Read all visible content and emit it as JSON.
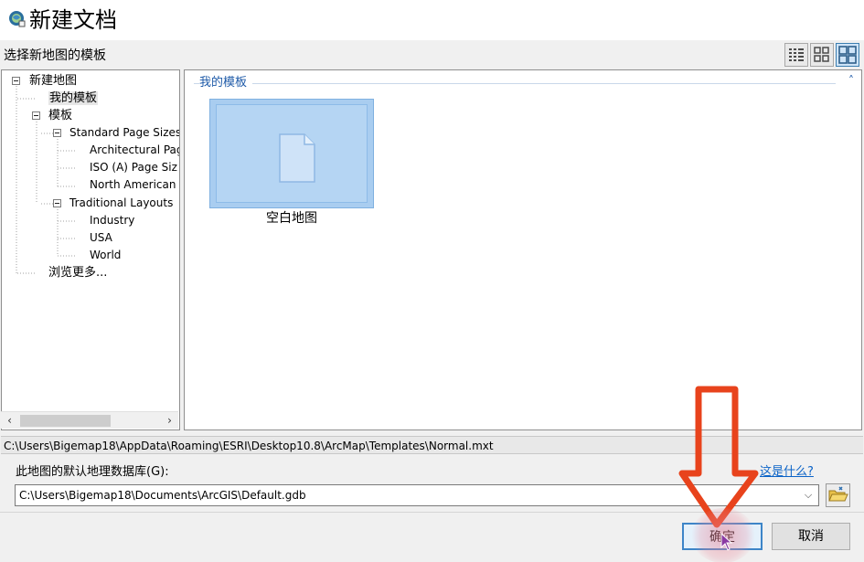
{
  "window": {
    "title": "新建文档",
    "app_icon": "arcmap-globe-icon"
  },
  "section": {
    "label": "选择新地图的模板",
    "view_buttons": [
      "details-view-icon",
      "medium-icons-view-icon",
      "large-icons-view-icon"
    ]
  },
  "tree": {
    "items": [
      {
        "label": "新建地图"
      },
      {
        "label": "我的模板"
      },
      {
        "label": "模板"
      },
      {
        "label": "Standard Page Sizes"
      },
      {
        "label": "Architectural Pag"
      },
      {
        "label": "ISO (A) Page Siz"
      },
      {
        "label": "North American ("
      },
      {
        "label": "Traditional Layouts"
      },
      {
        "label": "Industry"
      },
      {
        "label": "USA"
      },
      {
        "label": "World"
      },
      {
        "label": "浏览更多..."
      }
    ],
    "selected": "我的模板"
  },
  "content": {
    "group_title": "我的模板",
    "templates": [
      {
        "name": "空白地图",
        "icon": "blank-document-icon",
        "selected": true
      }
    ]
  },
  "path_bar": {
    "text": "C:\\Users\\Bigemap18\\AppData\\Roaming\\ESRI\\Desktop10.8\\ArcMap\\Templates\\Normal.mxt"
  },
  "gdb": {
    "label": "此地图的默认地理数据库(G):",
    "value": "C:\\Users\\Bigemap18\\Documents\\ArcGIS\\Default.gdb",
    "help_link": "这是什么?"
  },
  "buttons": {
    "ok": "确定",
    "cancel": "取消"
  },
  "colors": {
    "accent": "#3d85c8",
    "selection": "#a9cdf0",
    "arrow_annotation": "#e8431c"
  }
}
